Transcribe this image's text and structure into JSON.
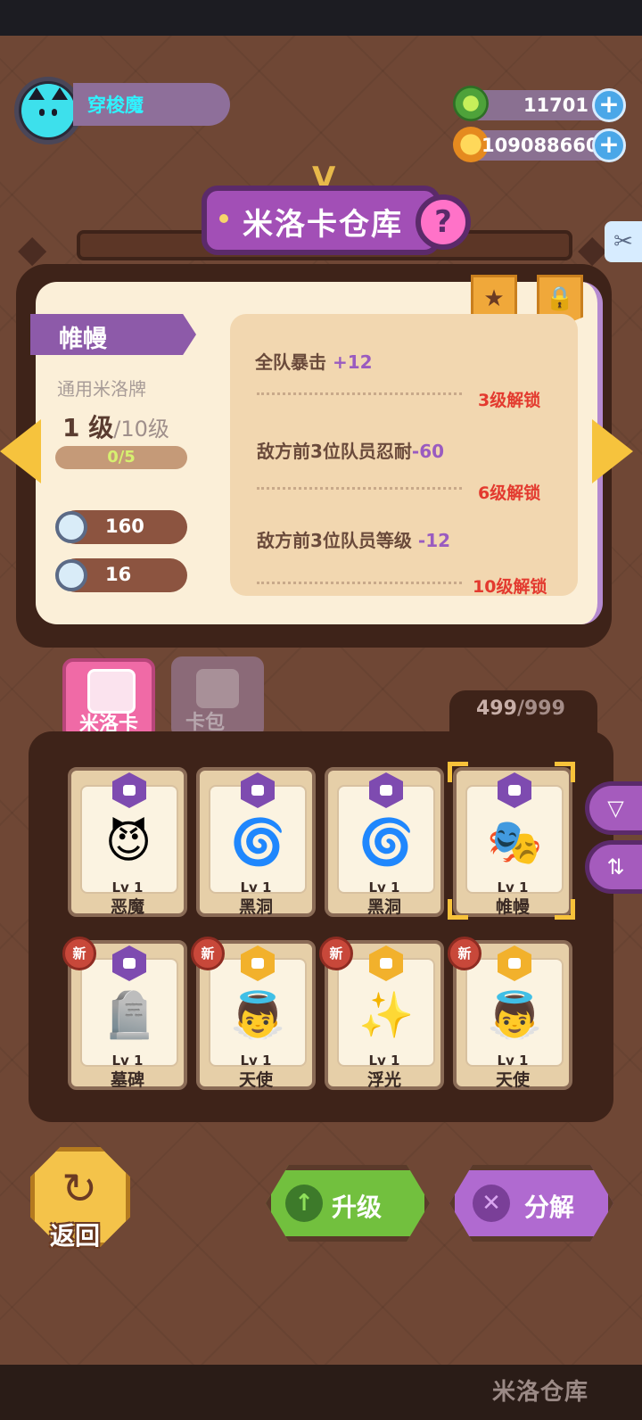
{
  "player": {
    "name": "穿梭魔"
  },
  "currency": {
    "gems": "11701",
    "coins": "109088660",
    "add_icon": "plus-icon"
  },
  "title": {
    "text": "米洛卡仓库",
    "help": "?"
  },
  "card_detail": {
    "name": "帷幔",
    "type": "通用米洛牌",
    "level_current": "1 级",
    "level_max": "/10级",
    "progress": "0/5",
    "progress_fraction": 0,
    "hp": "160",
    "defense": "16",
    "effects": [
      {
        "text": "全队暴击 ",
        "value": "+12",
        "unlock": "3级解锁"
      },
      {
        "text": "敌方前3位队员忍耐",
        "value": "-60",
        "unlock": "6级解锁"
      },
      {
        "text": "敌方前3位队员等级 ",
        "value": "-12",
        "unlock": "10级解锁"
      }
    ]
  },
  "tabs": [
    {
      "label": "米洛卡",
      "active": true
    },
    {
      "label": "卡包",
      "active": false
    }
  ],
  "capacity": {
    "current": "499",
    "max": "/999"
  },
  "cards": [
    {
      "lv": "Lv 1",
      "name": "恶魔",
      "rarity": "purple",
      "art": "devil",
      "new": false
    },
    {
      "lv": "Lv 1",
      "name": "黑洞",
      "rarity": "purple",
      "art": "black-hole",
      "new": false
    },
    {
      "lv": "Lv 1",
      "name": "黑洞",
      "rarity": "purple",
      "art": "black-hole",
      "new": false
    },
    {
      "lv": "Lv 1",
      "name": "帷幔",
      "rarity": "purple",
      "art": "curtain",
      "new": false,
      "selected": true
    },
    {
      "lv": "Lv 1",
      "name": "墓碑",
      "rarity": "purple",
      "art": "tombstone",
      "new": true
    },
    {
      "lv": "Lv 1",
      "name": "天使",
      "rarity": "gold",
      "art": "angel",
      "new": true
    },
    {
      "lv": "Lv 1",
      "name": "浮光",
      "rarity": "gold",
      "art": "star-light",
      "new": true
    },
    {
      "lv": "Lv 1",
      "name": "天使",
      "rarity": "gold",
      "art": "angel",
      "new": true
    }
  ],
  "new_label": "新",
  "buttons": {
    "back": "返回",
    "upgrade": "升级",
    "decompose": "分解"
  },
  "bottom_nav": {
    "label": "米洛仓库"
  },
  "colors": {
    "purple": "#7e4bb0",
    "gold": "#f2b12c",
    "accent": "#a24fb6",
    "upgrade": "#6fbf3a",
    "unlock": "#e33a2f"
  }
}
